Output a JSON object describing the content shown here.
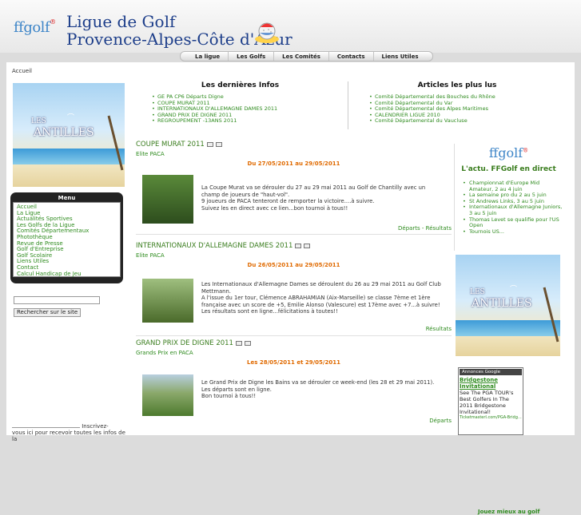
{
  "header": {
    "logo": "ffgolf",
    "logo_mark": "®",
    "title_line1": "Ligue de Golf",
    "title_line2": "Provence-Alpes-Côte d'Azur"
  },
  "nav": [
    "La ligue",
    "Les Golfs",
    "Les Comités",
    "Contacts",
    "Liens Utiles"
  ],
  "breadcrumb": "Accueil",
  "ad": {
    "les": "LES",
    "antilles": "ANTILLES"
  },
  "menu": {
    "title": "Menu",
    "items": [
      "Accueil",
      "La Ligue",
      "Actualités Sportives",
      "Les Golfs de la Ligue",
      "Comités Départementaux",
      "Photothèque",
      "Revue de Presse",
      "Golf d'Entreprise",
      "Golf Scolaire",
      "Liens Utiles",
      "Contact",
      "Calcul Handicap de Jeu"
    ]
  },
  "search": {
    "button": "Rechercher sur le site"
  },
  "newsletter": {
    "before": "Inscrivez-",
    "after": "vous ici pour recevoir toutes les infos de la"
  },
  "dernieres_infos": {
    "title": "Les dernières Infos",
    "items": [
      "GE PA CP6 Départs Digne",
      "COUPE MURAT 2011",
      "INTERNATIONAUX D'ALLEMAGNE DAMES 2011",
      "GRAND PRIX DE DIGNE 2011",
      "REGROUPEMENT -13ANS 2011"
    ]
  },
  "articles_plus_lus": {
    "title": "Articles les plus lus",
    "items": [
      "Comité Départemental des Bouches du Rhône",
      "Comité Départemental du Var",
      "Comité Départemental des Alpes Maritimes",
      "CALENDRIER LIGUE 2010",
      "Comité Départemental du Vaucluse"
    ]
  },
  "articles": [
    {
      "title": "COUPE MURAT 2011",
      "category": "Elite PACA",
      "date": "Du 27/05/2011 au 29/05/2011",
      "paragraphs": [
        "La Coupe Murat va se dérouler du 27 au 29 mai 2011 au Golf de Chantilly avec un champ de joueurs de \"haut-vol\".",
        "9 joueurs de PACA tenteront de remporter la victoire....à suivre.",
        "Suivez les en direct avec ce lien...bon tournoi à tous!!"
      ],
      "link": "Départs - Résultats"
    },
    {
      "title": "INTERNATIONAUX D'ALLEMAGNE DAMES 2011",
      "category": "Elite PACA",
      "date": "Du 26/05/2011 au 29/05/2011",
      "paragraphs": [
        "Les Internationaux d'Allemagne Dames se déroulent du 26 au 29 mai 2011 au Golf Club Mettmann.",
        "A l'issue du 1er tour, Clémence ABRAHAMIAN (Aix-Marseille) se classe 7ème et 1ère française avec un score de +5, Emilie Alonso (Valescure) est 17ème avec +7...à suivre!",
        "Les résultats sont en ligne...félicitations à toutes!!"
      ],
      "link": "Résultats"
    },
    {
      "title": "GRAND PRIX DE DIGNE 2011",
      "category": "Grands Prix en PACA",
      "date": "Les 28/05/2011 et 29/05/2011",
      "paragraphs": [
        "Le Grand Prix de Digne les Bains va se dérouler ce week-end (les 28 et 29 mai 2011).",
        "Les départs sont en ligne.",
        "Bon tournoi à tous!!"
      ],
      "link": "Départs"
    }
  ],
  "right": {
    "logo": "ffgolf",
    "actu_title": "L'actu. FFGolf en direct",
    "actu_items": [
      "Championnat d'Europe Mid Amateur, 2 au 4 juin",
      "La semaine pro du 2 au 5 juin",
      "St Andrews Links, 3 au 5 juin",
      "Internationaux d'Allemagne Juniors, 3 au 5 juin",
      "Thomas Levet se qualifie pour l'US Open",
      "Tournois US..."
    ],
    "adsense": {
      "header": "Annonces Google",
      "title": "Bridgestone Invitational",
      "body": "See The PGA TOUR's Best Golfers In The 2011 Bridgestone Invitational!",
      "url": "TicketmasterI.com/PGA-Bridg...",
      "more": "Jouez mieux au golf"
    }
  },
  "colors": {
    "link": "#2e8b1e",
    "date": "#e06a00",
    "brand_blue": "#3f86c8"
  }
}
